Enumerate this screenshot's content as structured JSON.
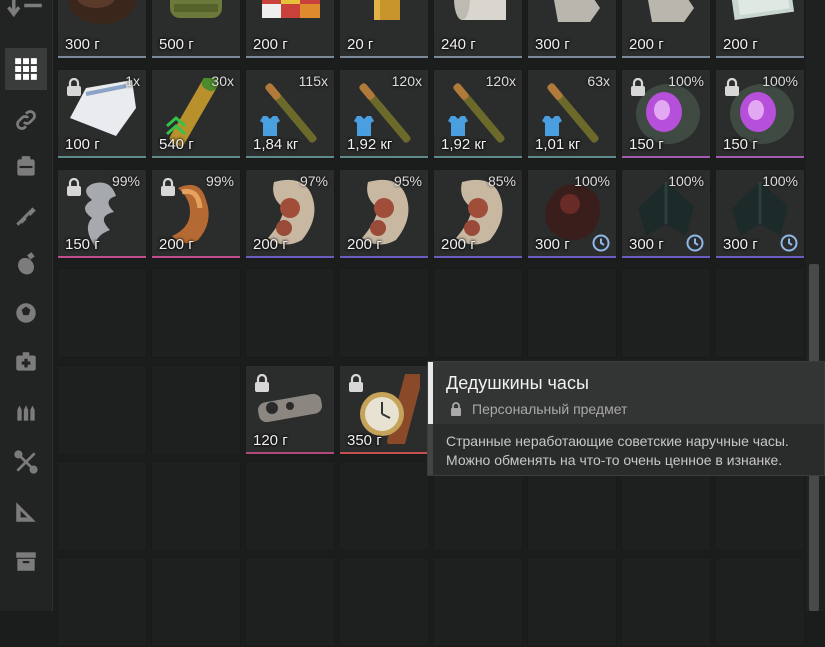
{
  "inventory": {
    "rows": [
      [
        {
          "weight": "300 г",
          "art": "fur",
          "rarity": "#7b8a9a"
        },
        {
          "weight": "500 г",
          "art": "can",
          "rarity": "#7b8a9a"
        },
        {
          "weight": "200 г",
          "art": "cube",
          "rarity": "#7b8a9a"
        },
        {
          "weight": "20 г",
          "art": "bar",
          "rarity": "#7b8a9a"
        },
        {
          "weight": "240 г",
          "art": "roll",
          "rarity": "#7b8a9a"
        },
        {
          "weight": "300 г",
          "art": "brush",
          "rarity": "#7b8a9a"
        },
        {
          "weight": "200 г",
          "art": "brush",
          "rarity": "#7b8a9a"
        },
        {
          "weight": "200 г",
          "art": "money",
          "rarity": "#7b8a9a"
        }
      ],
      [
        {
          "weight": "100 г",
          "qty": "1x",
          "art": "bag",
          "locked": true,
          "rarity": "#5f8a8a"
        },
        {
          "weight": "540 г",
          "qty": "30x",
          "art": "shell",
          "upgrade": true,
          "rarity": "#5f8a8a"
        },
        {
          "weight": "1,84 кг",
          "qty": "115x",
          "art": "round",
          "armor": true,
          "rarity": "#5f8a8a"
        },
        {
          "weight": "1,92 кг",
          "qty": "120x",
          "art": "round",
          "armor": true,
          "rarity": "#5f8a8a"
        },
        {
          "weight": "1,92 кг",
          "qty": "120x",
          "art": "round",
          "armor": true,
          "rarity": "#5f8a8a"
        },
        {
          "weight": "1,01 кг",
          "qty": "63x",
          "art": "round",
          "armor": true,
          "rarity": "#5f8a8a"
        },
        {
          "weight": "150 г",
          "qty": "100%",
          "art": "crystal",
          "locked": true,
          "rarity": "#a35bb2"
        },
        {
          "weight": "150 г",
          "qty": "100%",
          "art": "crystal",
          "locked": true,
          "rarity": "#a35bb2"
        }
      ],
      [
        {
          "weight": "150 г",
          "qty": "99%",
          "art": "drill",
          "locked": true,
          "rarity": "#c04d8e"
        },
        {
          "weight": "200 г",
          "qty": "99%",
          "art": "worm",
          "locked": true,
          "rarity": "#c04d8e"
        },
        {
          "weight": "200 г",
          "qty": "97%",
          "art": "lump",
          "rarity": "#6a5cc0"
        },
        {
          "weight": "200 г",
          "qty": "95%",
          "art": "lump",
          "rarity": "#6a5cc0"
        },
        {
          "weight": "200 г",
          "qty": "85%",
          "art": "lump",
          "rarity": "#6a5cc0"
        },
        {
          "weight": "300 г",
          "qty": "100%",
          "art": "dark",
          "clock": true,
          "rarity": "#6a5cc0"
        },
        {
          "weight": "300 г",
          "qty": "100%",
          "art": "leaf",
          "clock": true,
          "rarity": "#6a5cc0"
        },
        {
          "weight": "300 г",
          "qty": "100%",
          "art": "leaf",
          "clock": true,
          "rarity": "#6a5cc0"
        }
      ]
    ],
    "extra": [
      {
        "weight": "120 г",
        "art": "pipe",
        "locked": true,
        "rarity": "#b04a7a"
      },
      {
        "weight": "350 г",
        "art": "watch",
        "locked": true,
        "rarity": "#c45050"
      }
    ]
  },
  "tooltip": {
    "title": "Дедушкины часы",
    "subtitle": "Персональный предмет",
    "description": [
      "Странные неработающие советские наручные часы.",
      "Можно обменять на что-то очень ценное в изнанке."
    ]
  },
  "sidebar": {
    "icons": [
      "sort-icon",
      "grid-icon",
      "link-icon",
      "backpack-icon",
      "weapon-icon",
      "grenade-icon",
      "ball-icon",
      "medkit-icon",
      "ammo-icon",
      "tools-icon",
      "ruler-icon",
      "box-icon"
    ],
    "active": "grid-icon"
  },
  "colors": {
    "background": "#1b1c1c",
    "panel": "#2b2c2c",
    "accent_blue": "#4a9fe0",
    "upgrade_green": "#35c24a",
    "crystal_purple": "#b64fd9"
  }
}
